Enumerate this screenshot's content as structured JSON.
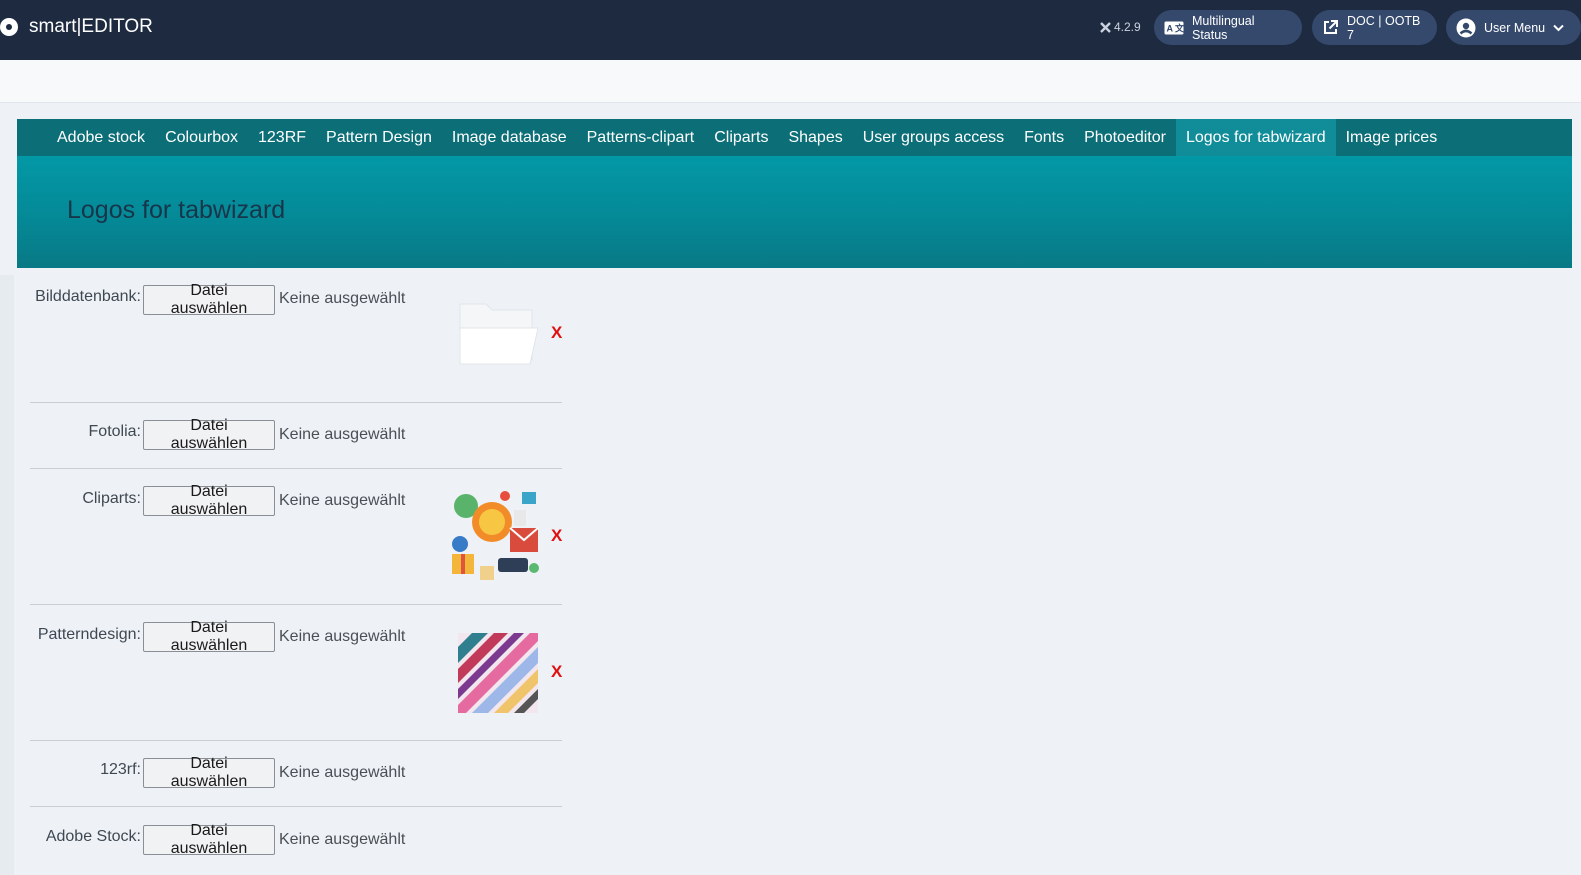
{
  "header": {
    "brand": "smart|EDITOR",
    "version": "4.2.9",
    "multilingual_label": "Multilingual Status",
    "doc_label": "DOC | OOTB 7",
    "user_menu_label": "User Menu"
  },
  "nav": {
    "items": [
      {
        "label": "Adobe stock"
      },
      {
        "label": "Colourbox"
      },
      {
        "label": "123RF"
      },
      {
        "label": "Pattern Design"
      },
      {
        "label": "Image database"
      },
      {
        "label": "Patterns-clipart"
      },
      {
        "label": "Cliparts"
      },
      {
        "label": "Shapes"
      },
      {
        "label": "User groups access"
      },
      {
        "label": "Fonts"
      },
      {
        "label": "Photoeditor"
      },
      {
        "label": "Logos for tabwizard"
      },
      {
        "label": "Image prices"
      }
    ],
    "active": "Logos for tabwizard"
  },
  "page": {
    "title": "Logos for tabwizard"
  },
  "form": {
    "button_label": "Datei auswählen",
    "no_file_text": "Keine ausgewählt",
    "delete_label": "X",
    "rows": [
      {
        "label": "Bilddatenbank:",
        "image": "folder-icon"
      },
      {
        "label": "Fotolia:",
        "image": null
      },
      {
        "label": "Cliparts:",
        "image": "cliparts-logo"
      },
      {
        "label": "Patterndesign:",
        "image": "pattern-logo"
      },
      {
        "label": "123rf:",
        "image": null
      },
      {
        "label": "Adobe Stock:",
        "image": null
      }
    ]
  },
  "colors": {
    "header_bg": "#1d2a40",
    "nav_bg": "#0c6e77",
    "nav_active": "#118c99",
    "hero_bg": "#0398a6",
    "delete_red": "#e01010"
  }
}
